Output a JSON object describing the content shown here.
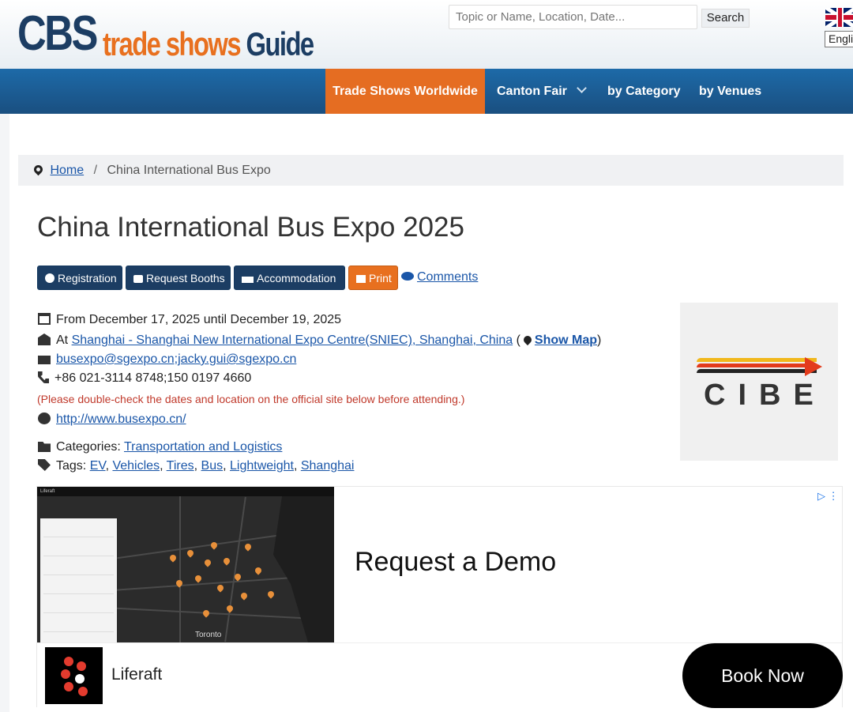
{
  "header": {
    "logo_main": "CBS",
    "logo_trade": "trade shows",
    "logo_guide": "Guide",
    "search_placeholder": "Topic or Name, Location, Date...",
    "search_button": "Search",
    "language": "English"
  },
  "nav": {
    "items": [
      {
        "label": "Trade Shows Worldwide"
      },
      {
        "label": "Canton Fair"
      },
      {
        "label": "by Category"
      },
      {
        "label": "by Venues"
      }
    ]
  },
  "breadcrumb": {
    "home": "Home",
    "separator": "/",
    "current": "China International Bus Expo"
  },
  "event": {
    "title": "China International Bus Expo 2025",
    "buttons": {
      "registration": "Registration",
      "request_booths": "Request Booths",
      "accommodation": "Accommodation",
      "print": "Print",
      "comments": "Comments"
    },
    "dates": "From December 17, 2025 until December 19, 2025",
    "at_label": "At",
    "venue": "Shanghai - Shanghai New International Expo Centre(SNIEC), Shanghai, China",
    "show_map": "Show Map",
    "email": "busexpo@sgexpo.cn;jacky.gui@sgexpo.cn",
    "phone": "+86 021-3114 8748;150 0197 4660",
    "warning": "(Please double-check the dates and location on the official site below before attending.)",
    "website": "http://www.busexpo.cn/",
    "categories_label": "Categories:",
    "category": "Transportation and Logistics",
    "tags_label": "Tags:",
    "tags": [
      "EV",
      "Vehicles",
      "Tires",
      "Bus",
      "Lightweight",
      "Shanghai"
    ],
    "logo_text": "CIBE"
  },
  "ad": {
    "headline": "Request a Demo",
    "brand": "Liferaft",
    "cta": "Book Now",
    "map_label": "Toronto",
    "map_app": "Liferaft"
  },
  "colors": {
    "nav_active": "#e56d22",
    "nav_bg": "#1a4f80",
    "button_dark": "#1c3d63",
    "link": "#1a56a8",
    "warning": "#c0392b"
  }
}
